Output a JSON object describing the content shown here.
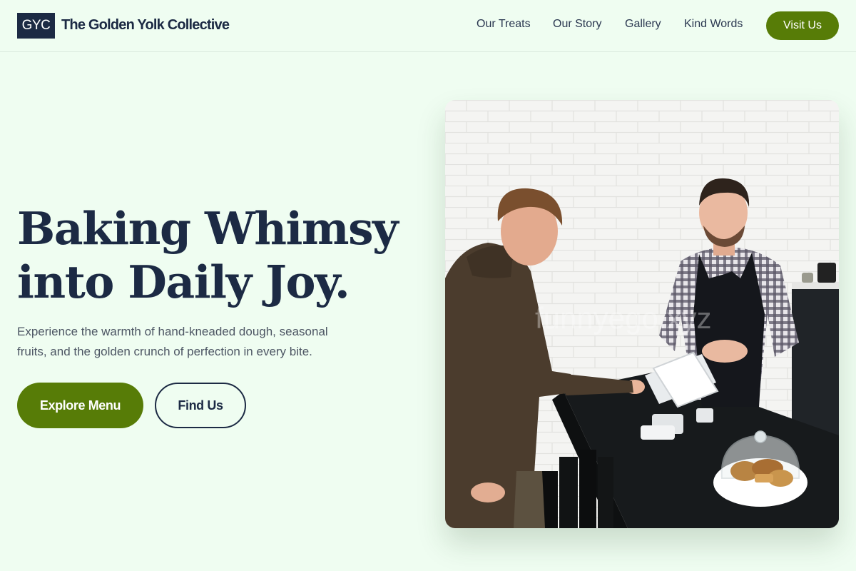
{
  "brand": {
    "logo_text": "GYC",
    "name": "The Golden Yolk Collective"
  },
  "nav": {
    "items": [
      {
        "label": "Our Treats"
      },
      {
        "label": "Our Story"
      },
      {
        "label": "Gallery"
      },
      {
        "label": "Kind Words"
      }
    ],
    "cta_label": "Visit Us"
  },
  "hero": {
    "title_line1": "Baking Whimsy",
    "title_line2": "into Daily Joy.",
    "subtitle_line1": "Experience the warmth of hand-kneaded dough, seasonal",
    "subtitle_line2": "fruits, and the golden crunch of perfection in every bite.",
    "primary_button": "Explore Menu",
    "secondary_button": "Find Us",
    "image_watermark": "funnyego.xyz"
  },
  "colors": {
    "background": "#effdf1",
    "navy": "#1c2a44",
    "accent_green": "#577c07"
  }
}
